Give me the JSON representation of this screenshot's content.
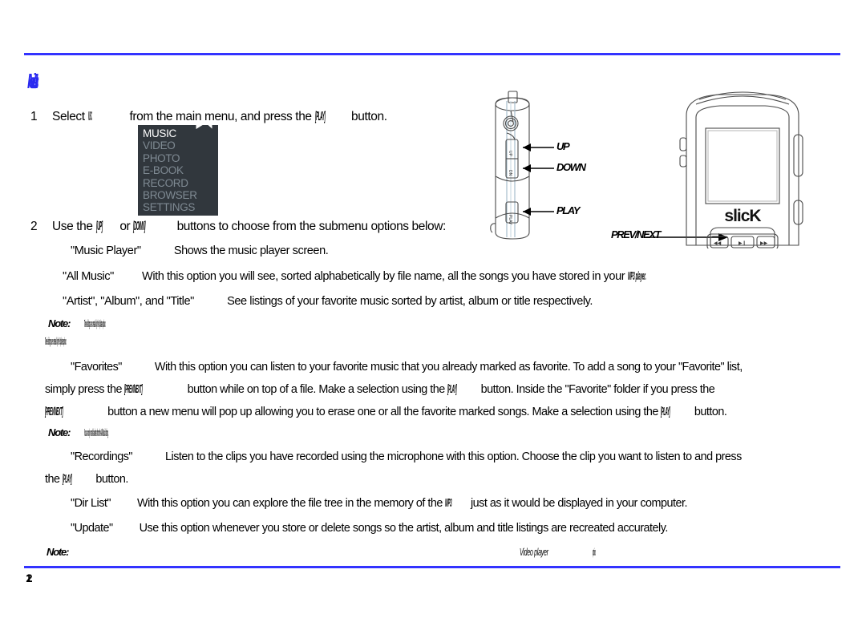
{
  "document": {
    "page_number": "12",
    "chapter_title": "Music"
  },
  "steps": [
    {
      "num": "1",
      "text_before": "Select",
      "ref1": "MUSIC",
      "text_mid": "from the main menu, and press the",
      "ref2": "[PLAY]",
      "text_after": "button."
    },
    {
      "num": "2",
      "text_before": "Use the",
      "ref1": "[UP]",
      "text_mid": "or",
      "ref2": "[DOWN]",
      "text_after": "buttons to choose from the submenu options below:"
    }
  ],
  "menu_screen": {
    "brand": "slick",
    "items": [
      {
        "label": "MUSIC",
        "selected": true
      },
      {
        "label": "VIDEO",
        "selected": false
      },
      {
        "label": "PHOTO",
        "selected": false
      },
      {
        "label": "E-BOOK",
        "selected": false
      },
      {
        "label": "RECORD",
        "selected": false
      },
      {
        "label": "BROWSER",
        "selected": false
      },
      {
        "label": "SETTINGS",
        "selected": false
      }
    ]
  },
  "options": [
    {
      "name": "\"Music Player\"",
      "desc": "Shows the music player screen."
    },
    {
      "name": "\"All Music\"",
      "desc": "With this option you will see, sorted alphabetically by file name, all the songs you have stored in your",
      "desc_ref": "MP3 player."
    },
    {
      "name": "\"Artist\", \"Album\", and \"Title\"",
      "desc": "See listings of your favorite music sorted by artist, album or title respectively."
    }
  ],
  "notes": [
    {
      "label": "Note:",
      "body": "These listings are created by the Update option."
    },
    {
      "label": "Note:",
      "body": "You can only mark favorites from the All Music listing."
    },
    {
      "label": "Note:",
      "body": "",
      "inline_ref": "Video player",
      "inline_tail": "option."
    }
  ],
  "favorites": {
    "name": "\"Favorites\"",
    "line1": "With this option you can listen to your favorite music that you already marked as favorite. To add a song to your \"Favorite\"  list,",
    "line2_a": "simply press the",
    "line2_ref": "[PREV/NEXT]",
    "line2_b": "button while on top of a file. Make a selection using the",
    "line2_ref2": "[PLAY]",
    "line2_c": "button. Inside the \"Favorite\"   folder if you press the",
    "line3_ref": "[PREV/NEXT]",
    "line3_a": "button a new menu will pop up allowing you to erase one or all the favorite marked songs. Make a selection using the",
    "line3_ref2": "[PLAY]",
    "line3_b": "button."
  },
  "recordings": {
    "name": "\"Recordings\"",
    "line1": "Listen to the clips you have recorded using the microphone with this option. Choose the clip you want to listen to and press",
    "line2_a": "the",
    "line2_ref": "[PLAY]",
    "line2_b": "button."
  },
  "dir_list": {
    "name": "\"Dir List\"",
    "desc_a": "With this option you can explore the file tree in the memory of the",
    "desc_ref": "MP3",
    "desc_b": "just as it would be displayed in your computer."
  },
  "update": {
    "name": "\"Update\"",
    "desc": "Use this option whenever you store or delete songs so the artist, album and title listings are recreated accurately."
  },
  "device_diagram": {
    "brand": "slicK",
    "callouts": [
      {
        "key": "up",
        "label": "UP"
      },
      {
        "key": "down",
        "label": "DOWN"
      },
      {
        "key": "play",
        "label": "PLAY"
      },
      {
        "key": "prevnext",
        "label": "PREV/NEXT"
      }
    ]
  },
  "colors": {
    "rule": "#3333ff",
    "title": "#2b2bf0",
    "screen_bg": "#31373d",
    "screen_item": "#7f8a93",
    "screen_item_selected": "#ffffff"
  }
}
